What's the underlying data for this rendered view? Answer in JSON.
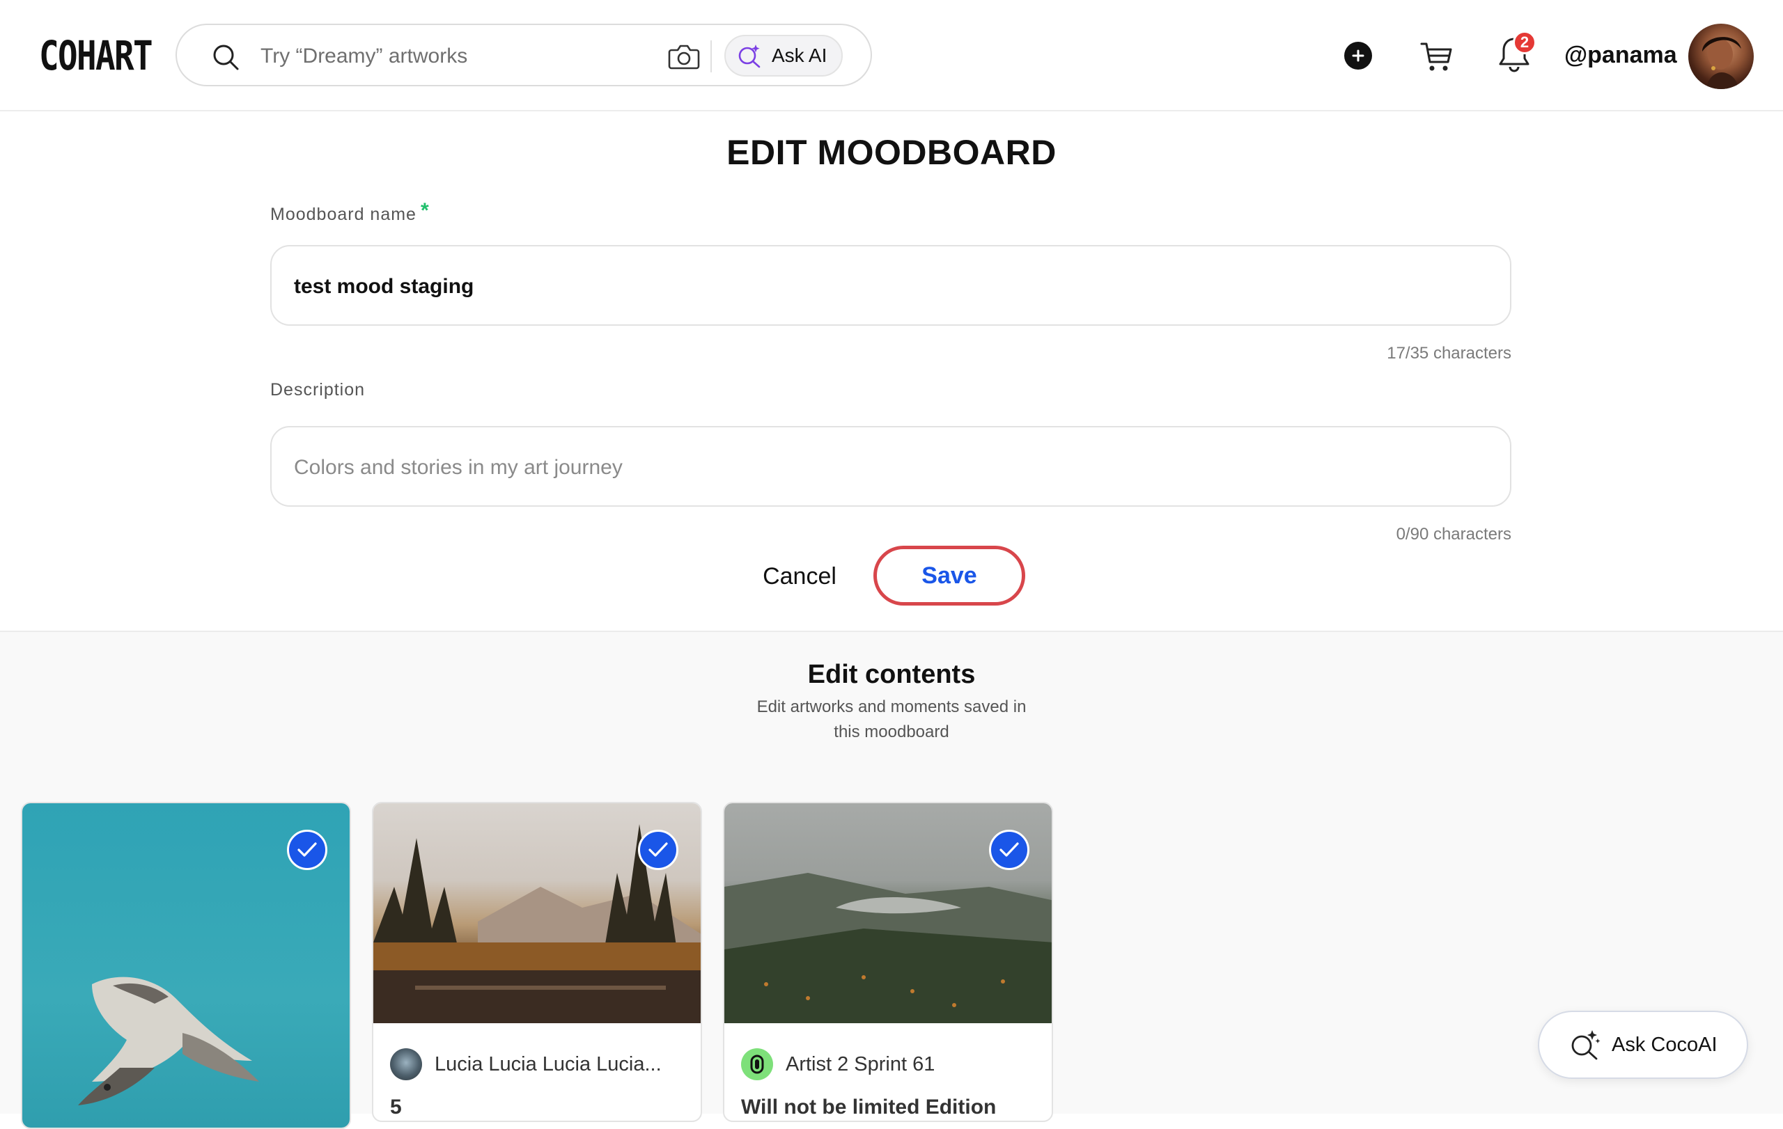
{
  "header": {
    "logo": "COHART",
    "search_placeholder": "Try “Dreamy” artworks",
    "ask_ai_label": "Ask AI",
    "notification_count": "2",
    "username": "@panama"
  },
  "edit": {
    "title": "EDIT MOODBOARD",
    "name_label": "Moodboard name",
    "required_mark": "*",
    "name_value": "test mood staging",
    "name_counter": "17/35 characters",
    "description_label": "Description",
    "description_placeholder": "Colors and stories in my art journey",
    "description_counter": "0/90 characters",
    "cancel_label": "Cancel",
    "save_label": "Save"
  },
  "contents": {
    "title": "Edit contents",
    "subtitle": "Edit artworks and moments saved in this moodboard",
    "cards": [
      {
        "artist": "",
        "title": "",
        "selected": true
      },
      {
        "artist": "Lucia Lucia Lucia Lucia...",
        "title": "5",
        "selected": true
      },
      {
        "artist": "Artist 2 Sprint 61",
        "title": "Will not be limited Edition",
        "selected": true
      }
    ]
  },
  "assistant": {
    "label": "Ask CocoAI"
  },
  "colors": {
    "accent_blue": "#1a56e8",
    "save_ring": "#d8464b",
    "required_green": "#1fbf6b",
    "badge_red": "#e53935"
  },
  "icons": [
    "search-icon",
    "camera-icon",
    "ai-sparkle-icon",
    "plus-icon",
    "cart-icon",
    "bell-icon",
    "check-icon"
  ]
}
